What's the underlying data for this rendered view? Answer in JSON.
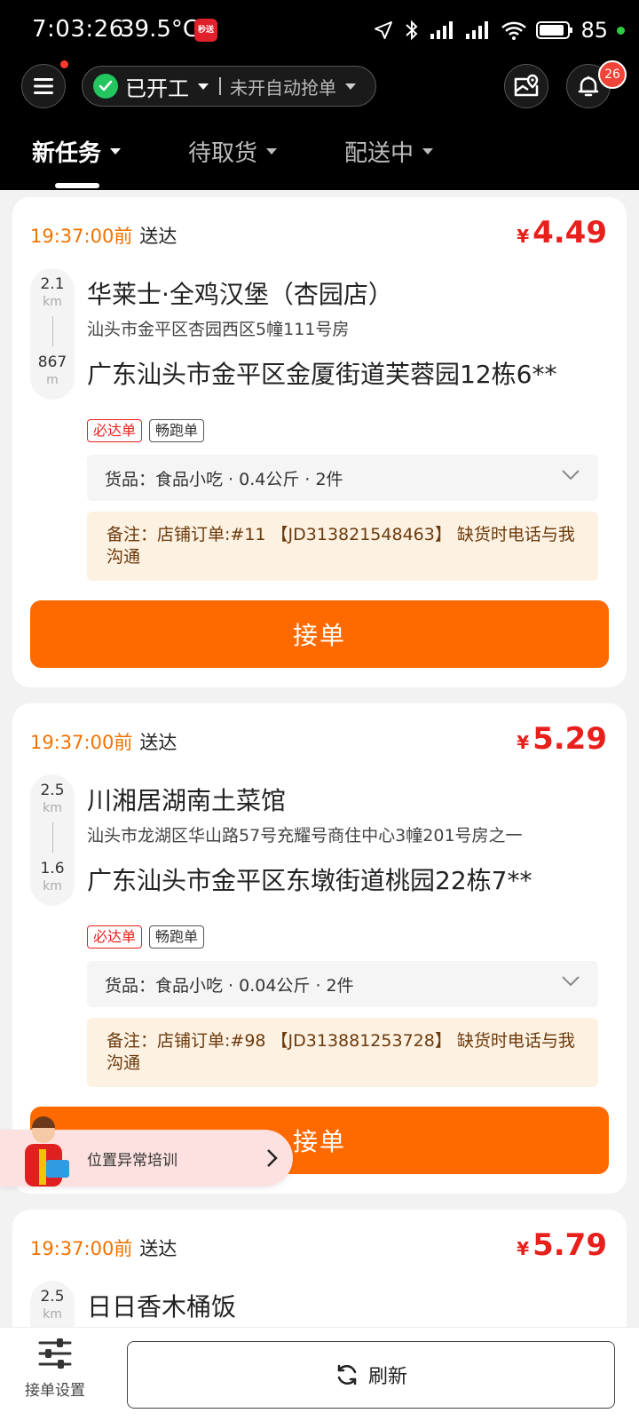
{
  "status_bar": {
    "time": "7:03:26",
    "temperature": "39.5°C",
    "app_badge": "秒送",
    "battery": "85"
  },
  "toolbar": {
    "work_status": "已开工",
    "auto_grab": "未开自动抢单",
    "notification_count": "26"
  },
  "tabs": [
    {
      "label": "新任务",
      "active": true
    },
    {
      "label": "待取货",
      "active": false
    },
    {
      "label": "配送中",
      "active": false
    }
  ],
  "orders": [
    {
      "deadline": "19:37:00前",
      "deliver": "送达",
      "currency": "¥",
      "price": "4.49",
      "dist_pickup": "2.1",
      "dist_pickup_unit": "km",
      "dist_drop": "867",
      "dist_drop_unit": "m",
      "shop": "华莱士·全鸡汉堡（杏园店）",
      "shop_address": "汕头市金平区杏园西区5幢111号房",
      "destination": "广东汕头市金平区金厦街道芙蓉园12栋6**",
      "tags": [
        "必达单",
        "畅跑单"
      ],
      "goods": "货品：食品小吃 · 0.4公斤 · 2件",
      "remark": "备注：店铺订单:#11 【JD313821548463】 缺货时电话与我沟通",
      "accept_label": "接单"
    },
    {
      "deadline": "19:37:00前",
      "deliver": "送达",
      "currency": "¥",
      "price": "5.29",
      "dist_pickup": "2.5",
      "dist_pickup_unit": "km",
      "dist_drop": "1.6",
      "dist_drop_unit": "km",
      "shop": "川湘居湖南土菜馆",
      "shop_address": "汕头市龙湖区华山路57号充耀号商住中心3幢201号房之一",
      "destination": "广东汕头市金平区东墩街道桃园22栋7**",
      "tags": [
        "必达单",
        "畅跑单"
      ],
      "goods": "货品：食品小吃 · 0.04公斤 · 2件",
      "remark": "备注：店铺订单:#98 【JD313881253728】 缺货时电话与我沟通",
      "accept_label": "接单"
    },
    {
      "deadline": "19:37:00前",
      "deliver": "送达",
      "currency": "¥",
      "price": "5.79",
      "dist_pickup": "2.5",
      "dist_pickup_unit": "km",
      "shop": "日日香木桶饭"
    }
  ],
  "promo": {
    "label": "位置异常培训"
  },
  "bottom_bar": {
    "settings_label": "接单设置",
    "refresh_label": "刷新"
  },
  "colors": {
    "accent": "#ff6a00",
    "price": "#e8201c",
    "deadline": "#f27200"
  }
}
